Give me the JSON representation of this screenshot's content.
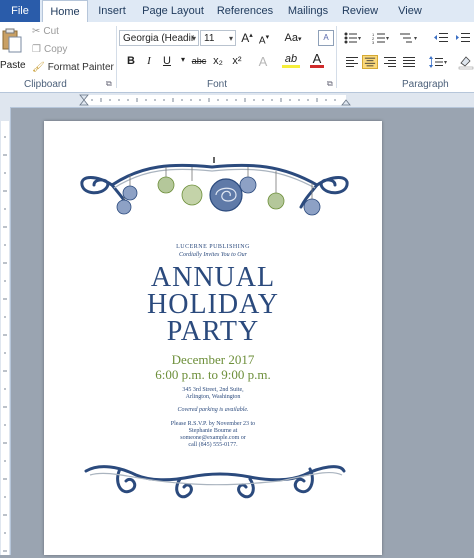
{
  "tabs": {
    "file": "File",
    "home": "Home",
    "insert": "Insert",
    "page_layout": "Page Layout",
    "references": "References",
    "mailings": "Mailings",
    "review": "Review",
    "view": "View"
  },
  "clipboard": {
    "paste": "Paste",
    "cut": "Cut",
    "copy": "Copy",
    "format_painter": "Format Painter",
    "label": "Clipboard"
  },
  "font": {
    "name": "Georgia (Headir",
    "size": "11",
    "label": "Font",
    "bold": "B",
    "italic": "I",
    "underline": "U",
    "strike": "abc",
    "subscript": "x₂",
    "superscript": "x²",
    "grow": "A",
    "shrink": "A",
    "case": "Aa",
    "highlight": "ab",
    "color": "A"
  },
  "paragraph": {
    "label": "Paragraph"
  },
  "invitation": {
    "publisher": "LUCERNE PUBLISHING",
    "invite_line": "Cordially Invites You to Our",
    "title_1": "ANNUAL",
    "title_2": "HOLIDAY",
    "title_3": "PARTY",
    "date": "December 2017",
    "time": "6:00 p.m. to 9:00 p.m.",
    "address_1": "345 3rd Street, 2nd Suite,",
    "address_2": "Arlington, Washington",
    "parking": "Covered parking is available.",
    "rsvp_1": "Please R.S.V.P. by November 23 to",
    "rsvp_2": "Stephanie Bourne at",
    "rsvp_3": "someone@example.com or",
    "rsvp_4": "call (845) 555-0177."
  },
  "colors": {
    "accent_blue": "#2b4a7d",
    "accent_green": "#6d8f3a",
    "ribbon_bg": "#ffffff",
    "file_tab": "#2a5caa"
  }
}
